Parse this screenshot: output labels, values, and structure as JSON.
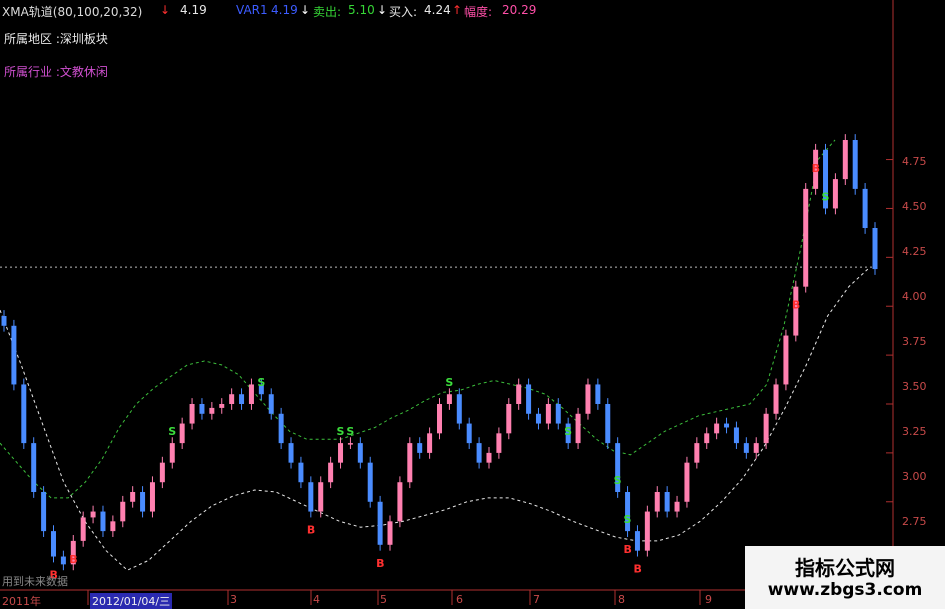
{
  "header": {
    "indicator": "XMA轨道(80,100,20,32)",
    "val1": "4.19",
    "var_label": "VAR1",
    "var_val": "4.19",
    "sell_label": "卖出:",
    "sell_val": "5.10",
    "buy_label": "买入:",
    "buy_val": "4.24",
    "amp_label": "幅度:",
    "amp_val": "20.29"
  },
  "info": {
    "region": "所属地区 :深圳板块",
    "industry": "所属行业 :文教休闲"
  },
  "axis": {
    "y_ticks": [
      "4.75",
      "4.50",
      "4.25",
      "4.00",
      "3.75",
      "3.50",
      "3.25",
      "3.00",
      "2.75"
    ],
    "x_ticks": [
      "2011年",
      "2012/01/04/三",
      "3",
      "4",
      "5",
      "6",
      "7",
      "8",
      "9"
    ]
  },
  "footer_note": "用到未来数据",
  "watermark": {
    "line1": "指标公式网",
    "line2": "www.zbgs3.com"
  },
  "chart_data": {
    "type": "candlestick",
    "ylim": [
      2.6,
      4.85
    ],
    "close_series": [
      3.9,
      3.6,
      3.3,
      3.05,
      2.85,
      2.72,
      2.68,
      2.8,
      2.92,
      2.95,
      2.85,
      2.9,
      3.0,
      3.05,
      2.95,
      3.1,
      3.2,
      3.3,
      3.4,
      3.5,
      3.45,
      3.48,
      3.5,
      3.55,
      3.5,
      3.6,
      3.55,
      3.45,
      3.3,
      3.2,
      3.1,
      2.95,
      3.1,
      3.2,
      3.3,
      3.3,
      3.2,
      3.0,
      2.78,
      2.9,
      3.1,
      3.3,
      3.25,
      3.35,
      3.5,
      3.55,
      3.4,
      3.3,
      3.2,
      3.25,
      3.35,
      3.5,
      3.6,
      3.45,
      3.4,
      3.5,
      3.4,
      3.3,
      3.45,
      3.6,
      3.5,
      3.3,
      3.05,
      2.85,
      2.75,
      2.95,
      3.05,
      2.95,
      3.0,
      3.2,
      3.3,
      3.35,
      3.4,
      3.38,
      3.3,
      3.25,
      3.3,
      3.45,
      3.6,
      3.85,
      4.1,
      4.6,
      4.8,
      4.5,
      4.65,
      4.85,
      4.6,
      4.4,
      4.19
    ],
    "upper_band": [
      3.3,
      3.2,
      3.1,
      3.02,
      3.02,
      3.1,
      3.22,
      3.38,
      3.5,
      3.58,
      3.64,
      3.7,
      3.72,
      3.7,
      3.65,
      3.55,
      3.45,
      3.36,
      3.32,
      3.32,
      3.32,
      3.35,
      3.38,
      3.43,
      3.47,
      3.52,
      3.56,
      3.57,
      3.6,
      3.62,
      3.6,
      3.58,
      3.55,
      3.48,
      3.4,
      3.32,
      3.26,
      3.24,
      3.3,
      3.36,
      3.4,
      3.44,
      3.46,
      3.48,
      3.5,
      3.6,
      3.9,
      4.3,
      4.75,
      4.85
    ],
    "lower_band": [
      3.98,
      3.7,
      3.4,
      3.1,
      2.9,
      2.75,
      2.65,
      2.7,
      2.8,
      2.9,
      2.98,
      3.03,
      3.06,
      3.05,
      3.0,
      2.95,
      2.9,
      2.87,
      2.88,
      2.9,
      2.93,
      2.96,
      3.0,
      3.02,
      3.02,
      2.99,
      2.95,
      2.9,
      2.86,
      2.82,
      2.8,
      2.8,
      2.83,
      2.9,
      3.0,
      3.12,
      3.28,
      3.48,
      3.7,
      3.95,
      4.1,
      4.2
    ],
    "mid_level": 4.2,
    "signals_buy": [
      "B",
      "B",
      "B",
      "B",
      "B",
      "B",
      "B",
      "B"
    ],
    "signals_sell": [
      "S",
      "S",
      "S",
      "S",
      "S",
      "S",
      "S",
      "S",
      "S"
    ]
  }
}
